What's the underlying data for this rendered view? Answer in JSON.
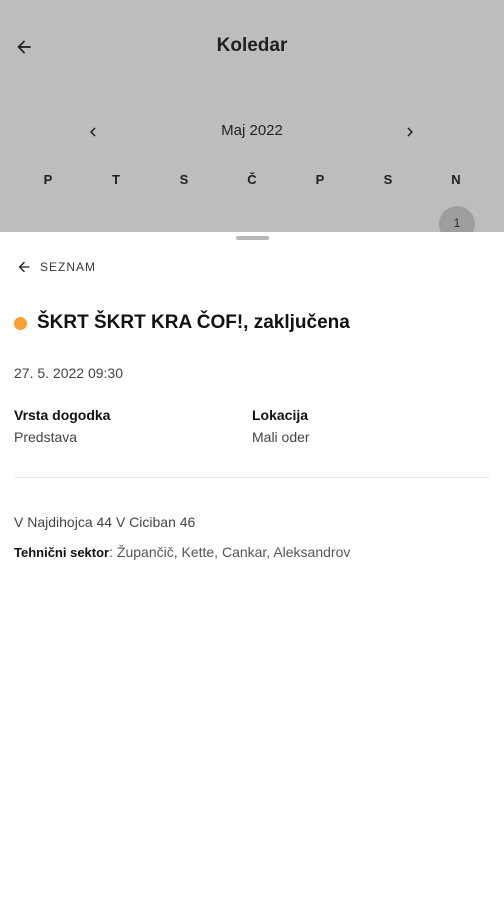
{
  "appbar": {
    "title": "Koledar"
  },
  "calendar": {
    "month_label": "Maj 2022",
    "weekdays": [
      "P",
      "T",
      "S",
      "Č",
      "P",
      "S",
      "N"
    ],
    "visible_day": "1"
  },
  "sheet": {
    "back_label": "SEZNAM",
    "event": {
      "title": "ŠKRT ŠKRT KRA ČOF!, zaključena",
      "status_color": "#f6a233",
      "datetime": "27. 5. 2022 09:30",
      "type_label": "Vrsta dogodka",
      "type_value": "Predstava",
      "location_label": "Lokacija",
      "location_value": "Mali oder",
      "description": "V Najdihojca 44 V Ciciban 46",
      "tech_label": "Tehnični sektor",
      "tech_value": ": Župančič, Kette, Cankar, Aleksandrov"
    }
  },
  "colors": {
    "header_bg": "#bdbdbd",
    "selected_day_bg": "#9e9e9e",
    "status_dot": "#f6a233"
  }
}
